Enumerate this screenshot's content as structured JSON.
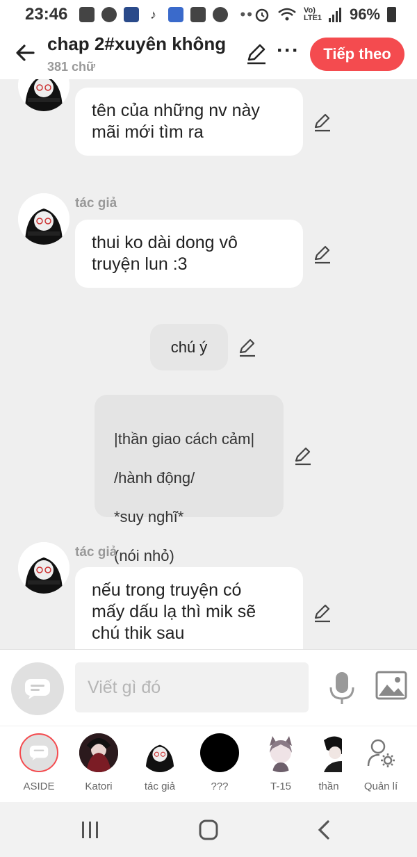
{
  "status_bar": {
    "time": "23:46",
    "network": "Vo) LTE1",
    "battery": "96%"
  },
  "header": {
    "title": "chap 2#xuyên không",
    "word_count": "381 chữ",
    "next_label": "Tiếp theo"
  },
  "messages": [
    {
      "sender": "",
      "text_lines": [
        "tên của những nv này",
        "mãi mới tìm ra"
      ]
    },
    {
      "sender": "tác giả",
      "text_lines": [
        "thui ko dài dong vô",
        "truyện lun :3"
      ]
    },
    {
      "sender": "",
      "text_lines": [
        "chú ý"
      ]
    },
    {
      "sender": "",
      "text_lines": [
        "|thần giao cách cảm|",
        "/hành động/",
        "*suy nghĩ*",
        "(nói nhỏ)",
        "..."
      ]
    },
    {
      "sender": "tác giả",
      "text_lines": [
        "nếu trong truyện có",
        "mấy dấu lạ thì mik sẽ",
        "chú thik sau"
      ]
    }
  ],
  "composer": {
    "placeholder": "Viết gì đó"
  },
  "characters": [
    {
      "name": "ASIDE"
    },
    {
      "name": "Katori"
    },
    {
      "name": "tác giả"
    },
    {
      "name": "???"
    },
    {
      "name": "T-15"
    },
    {
      "name": "thần"
    },
    {
      "name": "Quản lí"
    }
  ],
  "colors": {
    "accent": "#f44b4f",
    "background": "#efefef"
  }
}
